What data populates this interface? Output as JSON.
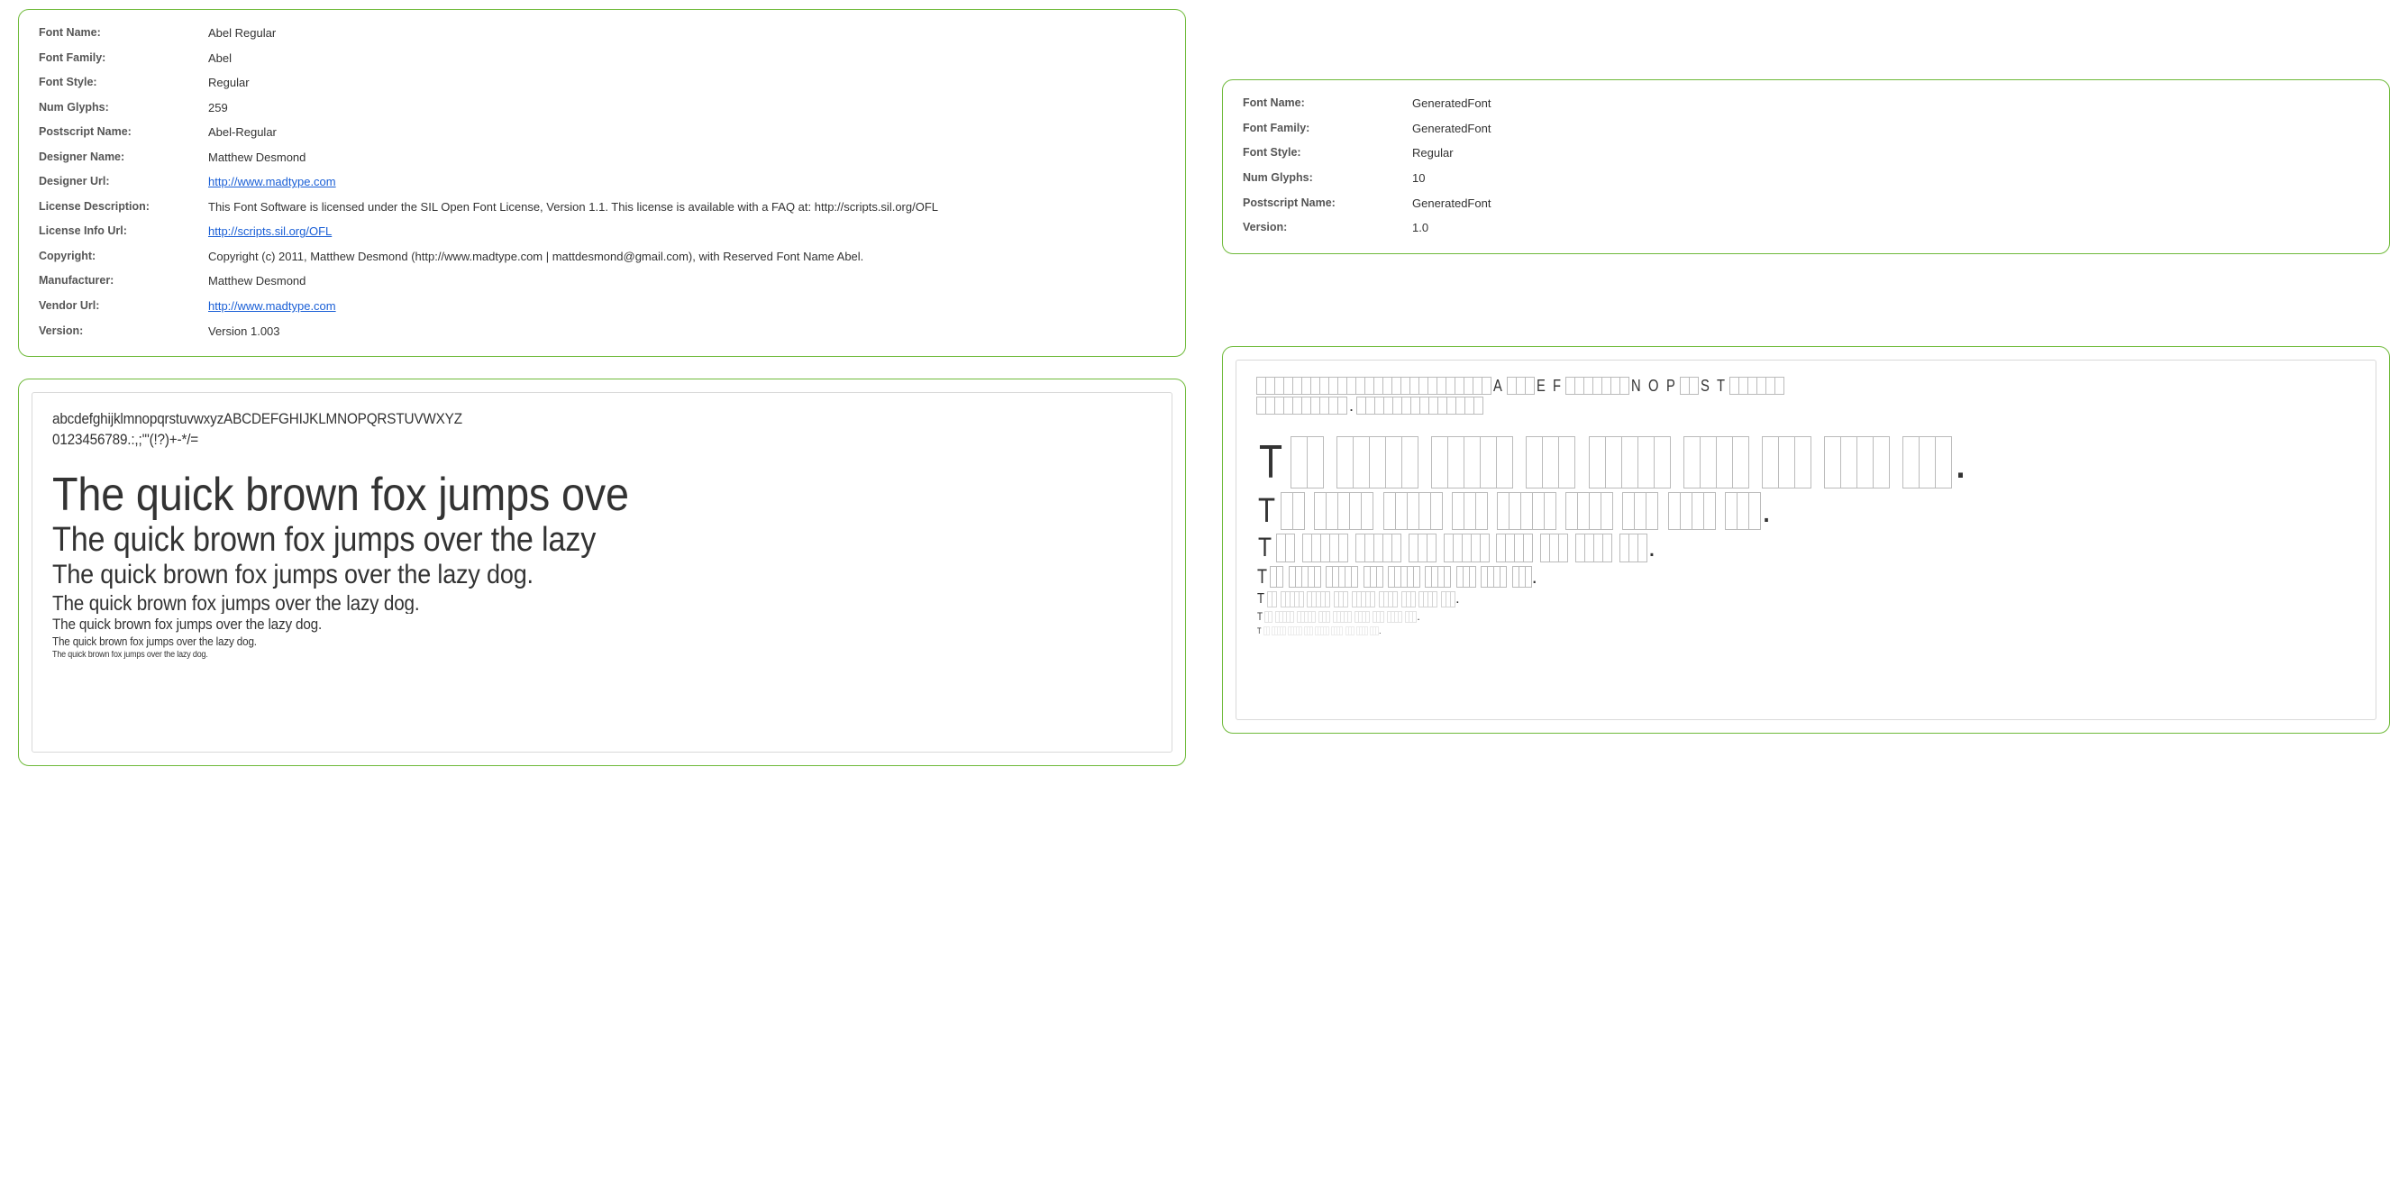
{
  "left": {
    "meta": [
      {
        "key": "Font Name:",
        "val": "Abel Regular"
      },
      {
        "key": "Font Family:",
        "val": "Abel"
      },
      {
        "key": "Font Style:",
        "val": "Regular"
      },
      {
        "key": "Num Glyphs:",
        "val": "259"
      },
      {
        "key": "Postscript Name:",
        "val": "Abel-Regular"
      },
      {
        "key": "Designer Name:",
        "val": "Matthew Desmond"
      },
      {
        "key": "Designer Url:",
        "val": "http://www.madtype.com",
        "link": true
      },
      {
        "key": "License Description:",
        "val": "This Font Software is licensed under the SIL Open Font License, Version 1.1. This license is available with a FAQ at: http://scripts.sil.org/OFL"
      },
      {
        "key": "License Info Url:",
        "val": "http://scripts.sil.org/OFL",
        "link": true
      },
      {
        "key": "Copyright:",
        "val": "Copyright (c) 2011, Matthew Desmond (http://www.madtype.com | mattdesmond@gmail.com), with Reserved Font Name Abel."
      },
      {
        "key": "Manufacturer:",
        "val": "Matthew Desmond"
      },
      {
        "key": "Vendor Url:",
        "val": "http://www.madtype.com",
        "link": true
      },
      {
        "key": "Version:",
        "val": "Version 1.003"
      }
    ],
    "preview": {
      "charset_line1": "abcdefghijklmnopqrstuvwxyzABCDEFGHIJKLMNOPQRSTUVWXYZ",
      "charset_line2": "0123456789.:,;'\"(!?)+-*/=",
      "pangram_full": "The quick brown fox jumps over the lazy dog.",
      "w1_text": "The quick brown fox jumps ove",
      "w2_text": "The quick brown fox jumps over the lazy"
    }
  },
  "right": {
    "meta": [
      {
        "key": "Font Name:",
        "val": "GeneratedFont"
      },
      {
        "key": "Font Family:",
        "val": "GeneratedFont"
      },
      {
        "key": "Font Style:",
        "val": "Regular"
      },
      {
        "key": "Num Glyphs:",
        "val": "10"
      },
      {
        "key": "Postscript Name:",
        "val": "GeneratedFont"
      },
      {
        "key": "Version:",
        "val": "1.0"
      }
    ],
    "available_glyphs": [
      "A",
      "E",
      "F",
      "N",
      "O",
      "P",
      "S",
      "T",
      "."
    ],
    "preview": {
      "charset_full": "abcdefghijklmnopqrstuvwxyzABCDEFGHIJKLMNOPQRSTUVWXYZ0123456789.:,;'\"(!?)+-*/=",
      "charset_line1": "abcdefghijklmnopqrstuvwxyzABCDEFGHIJKLMNOPQRSTUVWXYZ",
      "charset_line2": "0123456789.:,;'\"(!?)+-*/=",
      "pangram": "The quick brown fox jumps over the lazy dog."
    }
  }
}
